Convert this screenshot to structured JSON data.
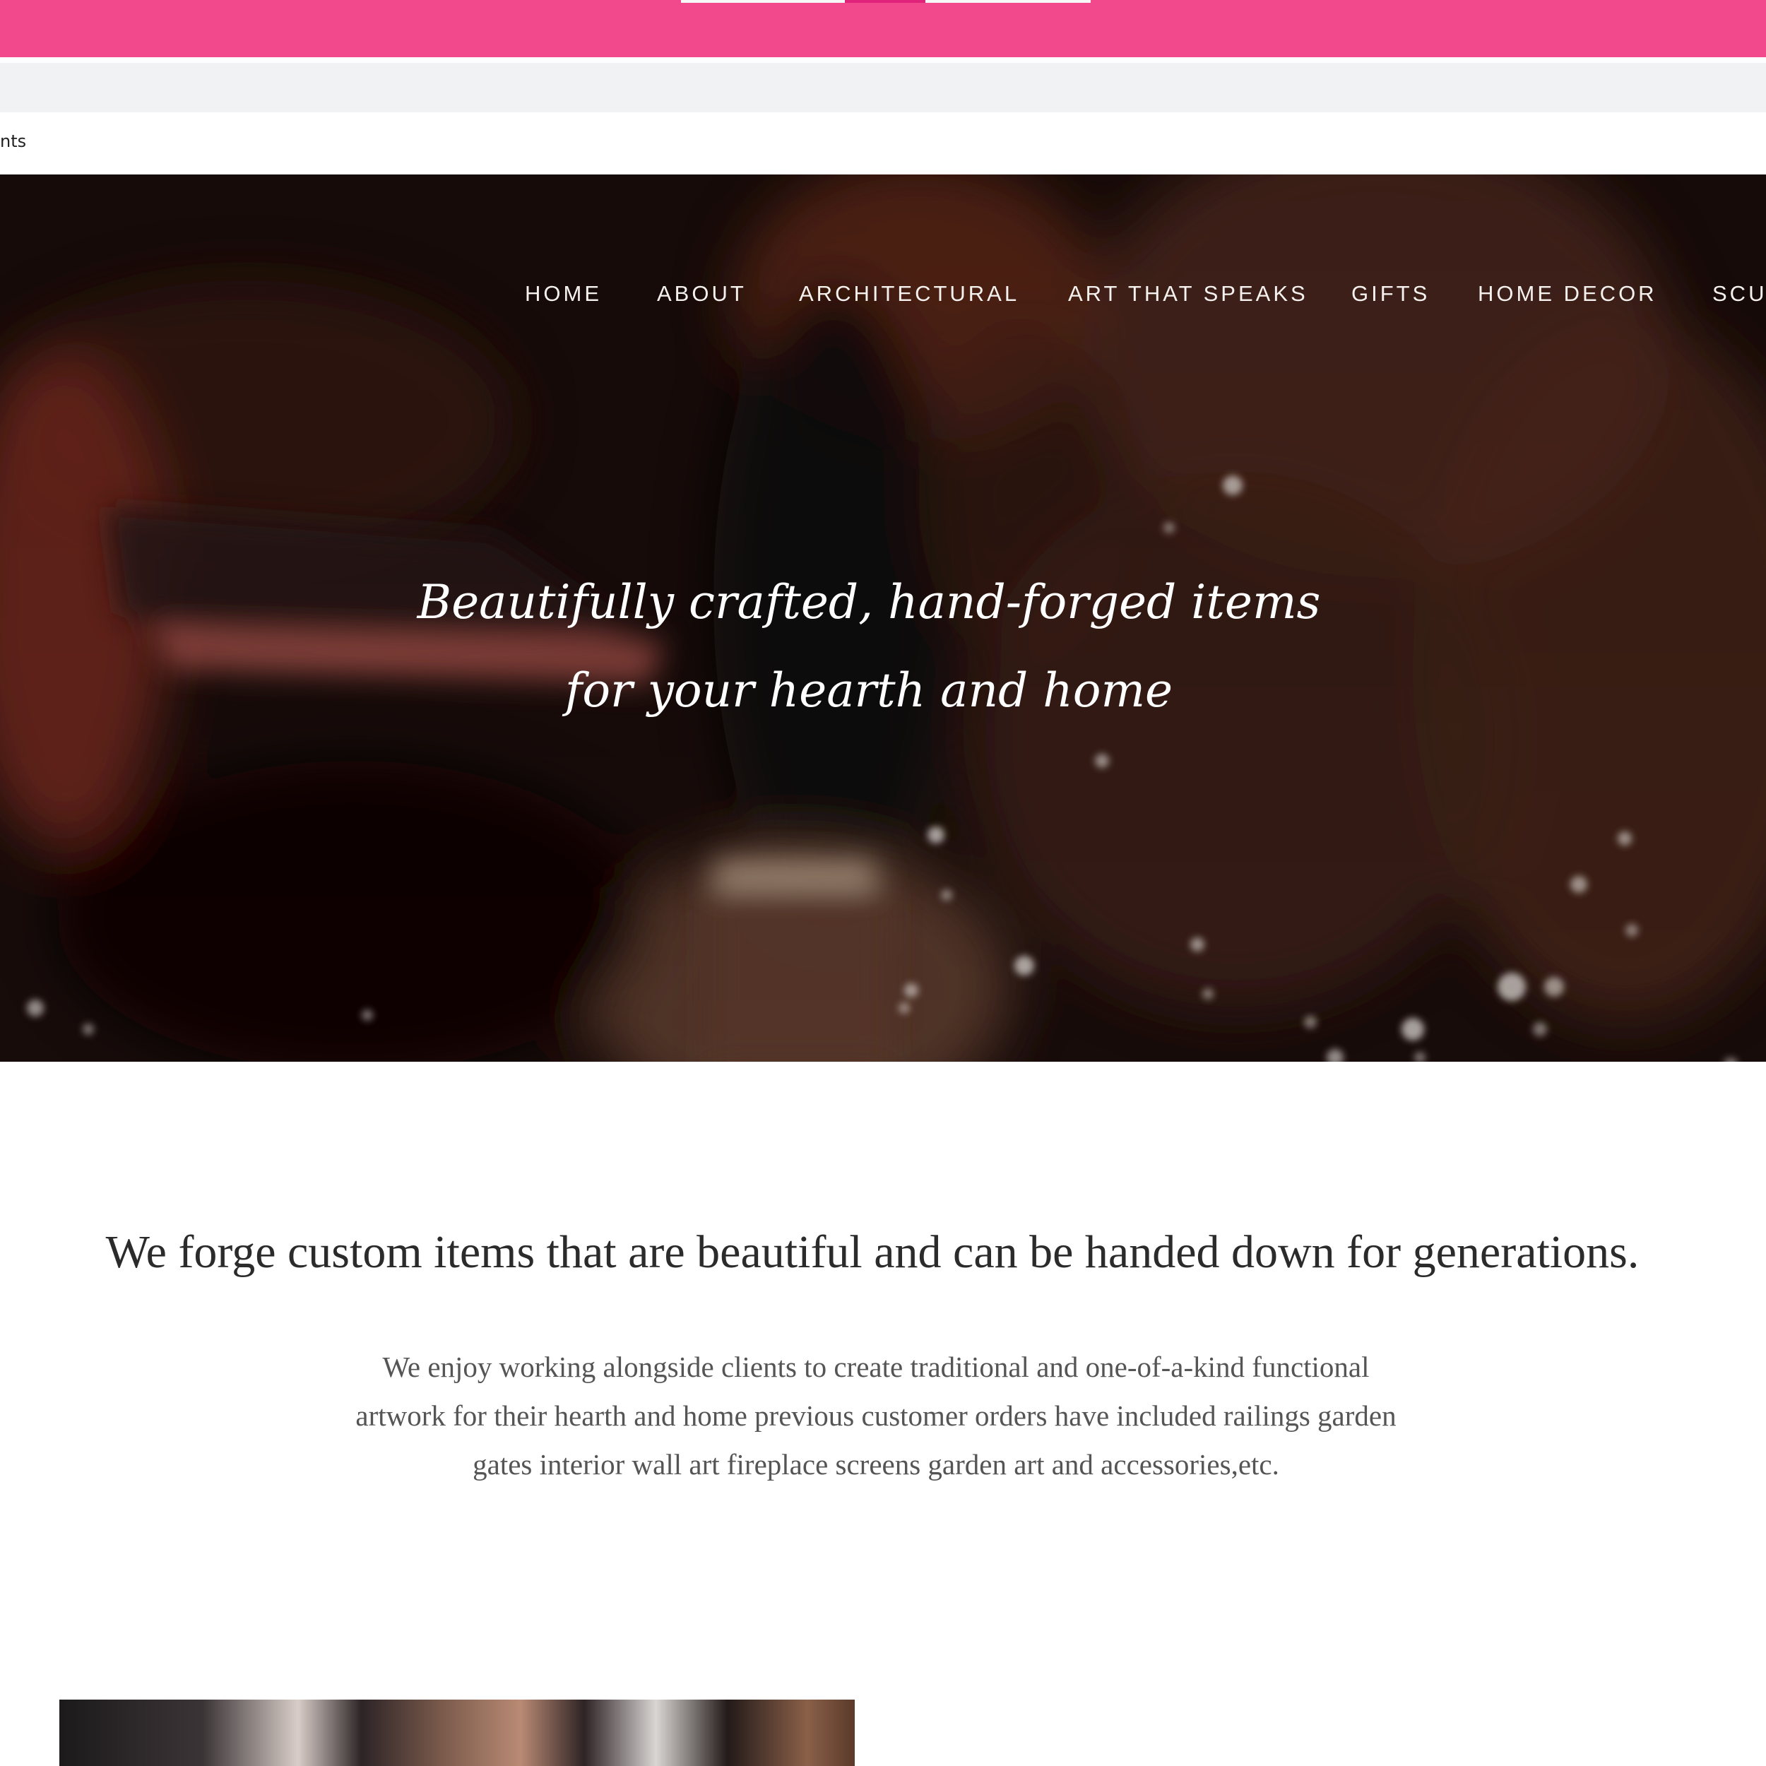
{
  "browser": {
    "bookmark_fragment": "nts"
  },
  "nav": {
    "items": [
      "HOME",
      "ABOUT",
      "ARCHITECTURAL",
      "ART THAT SPEAKS",
      "GIFTS",
      "HOME DECOR",
      "SCU"
    ]
  },
  "hero": {
    "tagline_line1": "Beautifully crafted, hand-forged items",
    "tagline_line2": "for your hearth and home"
  },
  "intro": {
    "heading": "We forge custom items that are beautiful and can be handed down for generations.",
    "body_line1": "We enjoy working  alongside clients to create traditional and one-of-a-kind functional",
    "body_line2": "artwork for their hearth and home previous customer orders have included railings garden",
    "body_line3": "gates interior wall art fireplace screens garden art and accessories,etc."
  },
  "colors": {
    "browser_accent": "#f2498d",
    "hero_text": "#ffffff",
    "heading_text": "#2b2b2b",
    "body_text": "#555555"
  }
}
